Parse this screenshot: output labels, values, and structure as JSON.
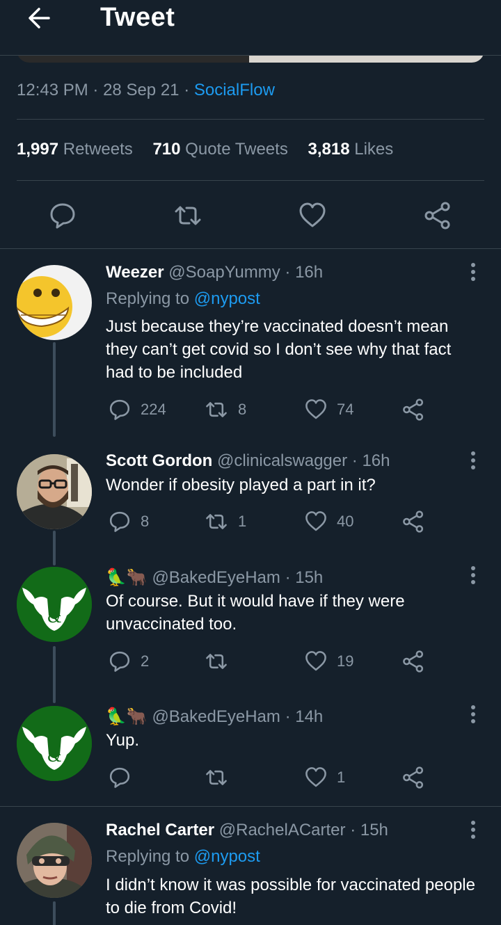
{
  "header": {
    "title": "Tweet",
    "back_icon": "arrow-left-icon"
  },
  "tweet": {
    "time": "12:43 PM",
    "date": "28 Sep 21",
    "source": "SocialFlow",
    "stats": {
      "retweets": "1,997",
      "retweets_label": "Retweets",
      "quotes": "710",
      "quotes_label": "Quote Tweets",
      "likes": "3,818",
      "likes_label": "Likes"
    }
  },
  "replies": [
    {
      "name": "Weezer",
      "handle": "@SoapYummy",
      "time": "16h",
      "replying_prefix": "Replying to",
      "replying_to": "@nypost",
      "text": "Just because they’re vaccinated doesn’t mean they can’t get covid so I don’t see why that fact had to be included",
      "reply_count": "224",
      "retweet_count": "8",
      "like_count": "74"
    },
    {
      "name": "Scott Gordon",
      "handle": "@clinicalswagger",
      "time": "16h",
      "text": "Wonder if obesity played a part in it?",
      "reply_count": "8",
      "retweet_count": "1",
      "like_count": "40"
    },
    {
      "name": "🦜🐂",
      "handle": "@BakedEyeHam",
      "time": "15h",
      "text": "Of course. But it would have if they were unvaccinated too.",
      "reply_count": "2",
      "retweet_count": "",
      "like_count": "19"
    },
    {
      "name": "🦜🐂",
      "handle": "@BakedEyeHam",
      "time": "14h",
      "text": "Yup.",
      "reply_count": "",
      "retweet_count": "",
      "like_count": "1"
    },
    {
      "name": "Rachel Carter",
      "handle": "@RachelACarter",
      "time": "15h",
      "replying_prefix": "Replying to",
      "replying_to": "@nypost",
      "text": "I didn’t know it was possible for vaccinated people to die from Covid!"
    }
  ],
  "colors": {
    "background": "#15202b",
    "accent": "#1d9bf0",
    "muted": "#8b98a5",
    "divider": "#38444d"
  }
}
